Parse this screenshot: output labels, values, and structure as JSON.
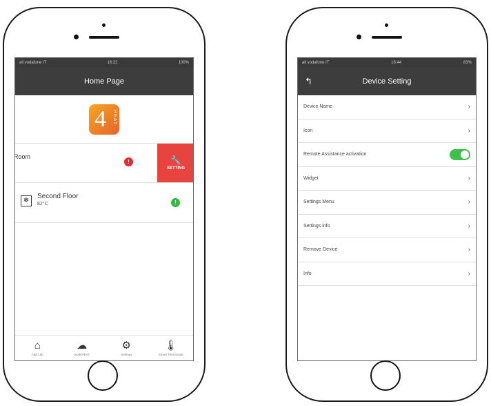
{
  "left_phone": {
    "status_bar": {
      "carrier": "all vodafone IT",
      "time": "16:22",
      "battery": "100%"
    },
    "nav_title": "Home Page",
    "logo": {
      "text": "4",
      "sub": "HEAT"
    },
    "room": {
      "label": "Room",
      "badge": "!",
      "setting_label": "SETTING"
    },
    "device": {
      "name": "Second Floor",
      "temp": "82°C",
      "badge": "!"
    },
    "tabs": [
      {
        "label": "Add Lab",
        "icon": "home-add-icon"
      },
      {
        "label": "mod4HEAT",
        "icon": "cloud-icon"
      },
      {
        "label": "Settings",
        "icon": "gear-icon"
      },
      {
        "label": "Smart Thermostat",
        "icon": "thermostat-icon"
      }
    ]
  },
  "right_phone": {
    "status_bar": {
      "carrier": "all vodafone IT",
      "time": "16:44",
      "battery": "83%"
    },
    "nav_title": "Device Setting",
    "items": [
      {
        "label": "Device Name"
      },
      {
        "label": "Icon"
      },
      {
        "label": "Remote Assistance activation"
      },
      {
        "label": "Widget"
      },
      {
        "label": "Settings Menu"
      },
      {
        "label": "Settings info"
      },
      {
        "label": "Remove Device"
      },
      {
        "label": "Info"
      }
    ],
    "remote_assistance_enabled": true
  },
  "colors": {
    "navbar": "#3d3d3d",
    "accent_red": "#e8443f",
    "green": "#3cc24a"
  }
}
